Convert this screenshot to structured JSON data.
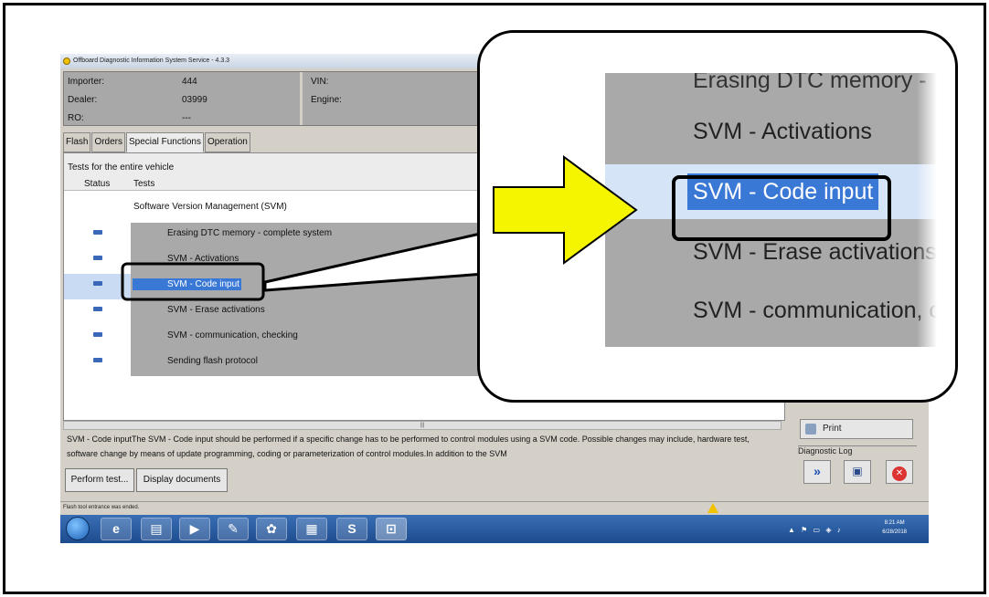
{
  "window": {
    "title": "Offboard Diagnostic Information System Service - 4.3.3"
  },
  "info": {
    "importer_label": "Importer:",
    "importer_value": "444",
    "dealer_label": "Dealer:",
    "dealer_value": "03999",
    "ro_label": "RO:",
    "ro_value": "---",
    "vin_label": "VIN:",
    "engine_label": "Engine:"
  },
  "tabs": [
    {
      "label": "Flash"
    },
    {
      "label": "Orders"
    },
    {
      "label": "Special Functions"
    },
    {
      "label": "Operation"
    }
  ],
  "panel": {
    "caption": "Tests for the entire vehicle",
    "col_status": "Status",
    "col_tests": "Tests",
    "group": "Software Version Management (SVM)"
  },
  "tests": [
    {
      "label": "Erasing DTC memory - complete system"
    },
    {
      "label": "SVM - Activations"
    },
    {
      "label": "SVM - Code input",
      "selected": true
    },
    {
      "label": "SVM - Erase activations"
    },
    {
      "label": "SVM - communication, checking"
    },
    {
      "label": "Sending flash protocol"
    }
  ],
  "description": "SVM - Code inputThe SVM - Code input should be performed if a specific change has to be performed to control modules using a SVM code. Possible changes may include, hardware test, software change by means of update programming, coding or parameterization of control modules.In addition to the SVM",
  "buttons": {
    "perform": "Perform test...",
    "display": "Display documents",
    "print": "Print"
  },
  "right": {
    "diag_log": "Diagnostic Log"
  },
  "statusbar": {
    "text": "Flash tool entrance was ended."
  },
  "tray": {
    "time": "8:21 AM",
    "date": "6/28/2018"
  },
  "zoom": {
    "rows": [
      "Erasing DTC memory -",
      "SVM - Activations",
      "SVM - Code input",
      "SVM - Erase activations",
      "SVM - communication, c"
    ]
  },
  "colors": {
    "selection": "#3a78d6",
    "arrow": "#f5f500",
    "row_bg": "#a9a9a9"
  },
  "icons": [
    "app-icon",
    "start-orb",
    "ie-icon",
    "folder-icon",
    "media-icon",
    "paint-icon",
    "grid-icon",
    "skype-icon",
    "car-icon",
    "warning-icon",
    "print-icon",
    "next-icon",
    "close-icon"
  ]
}
